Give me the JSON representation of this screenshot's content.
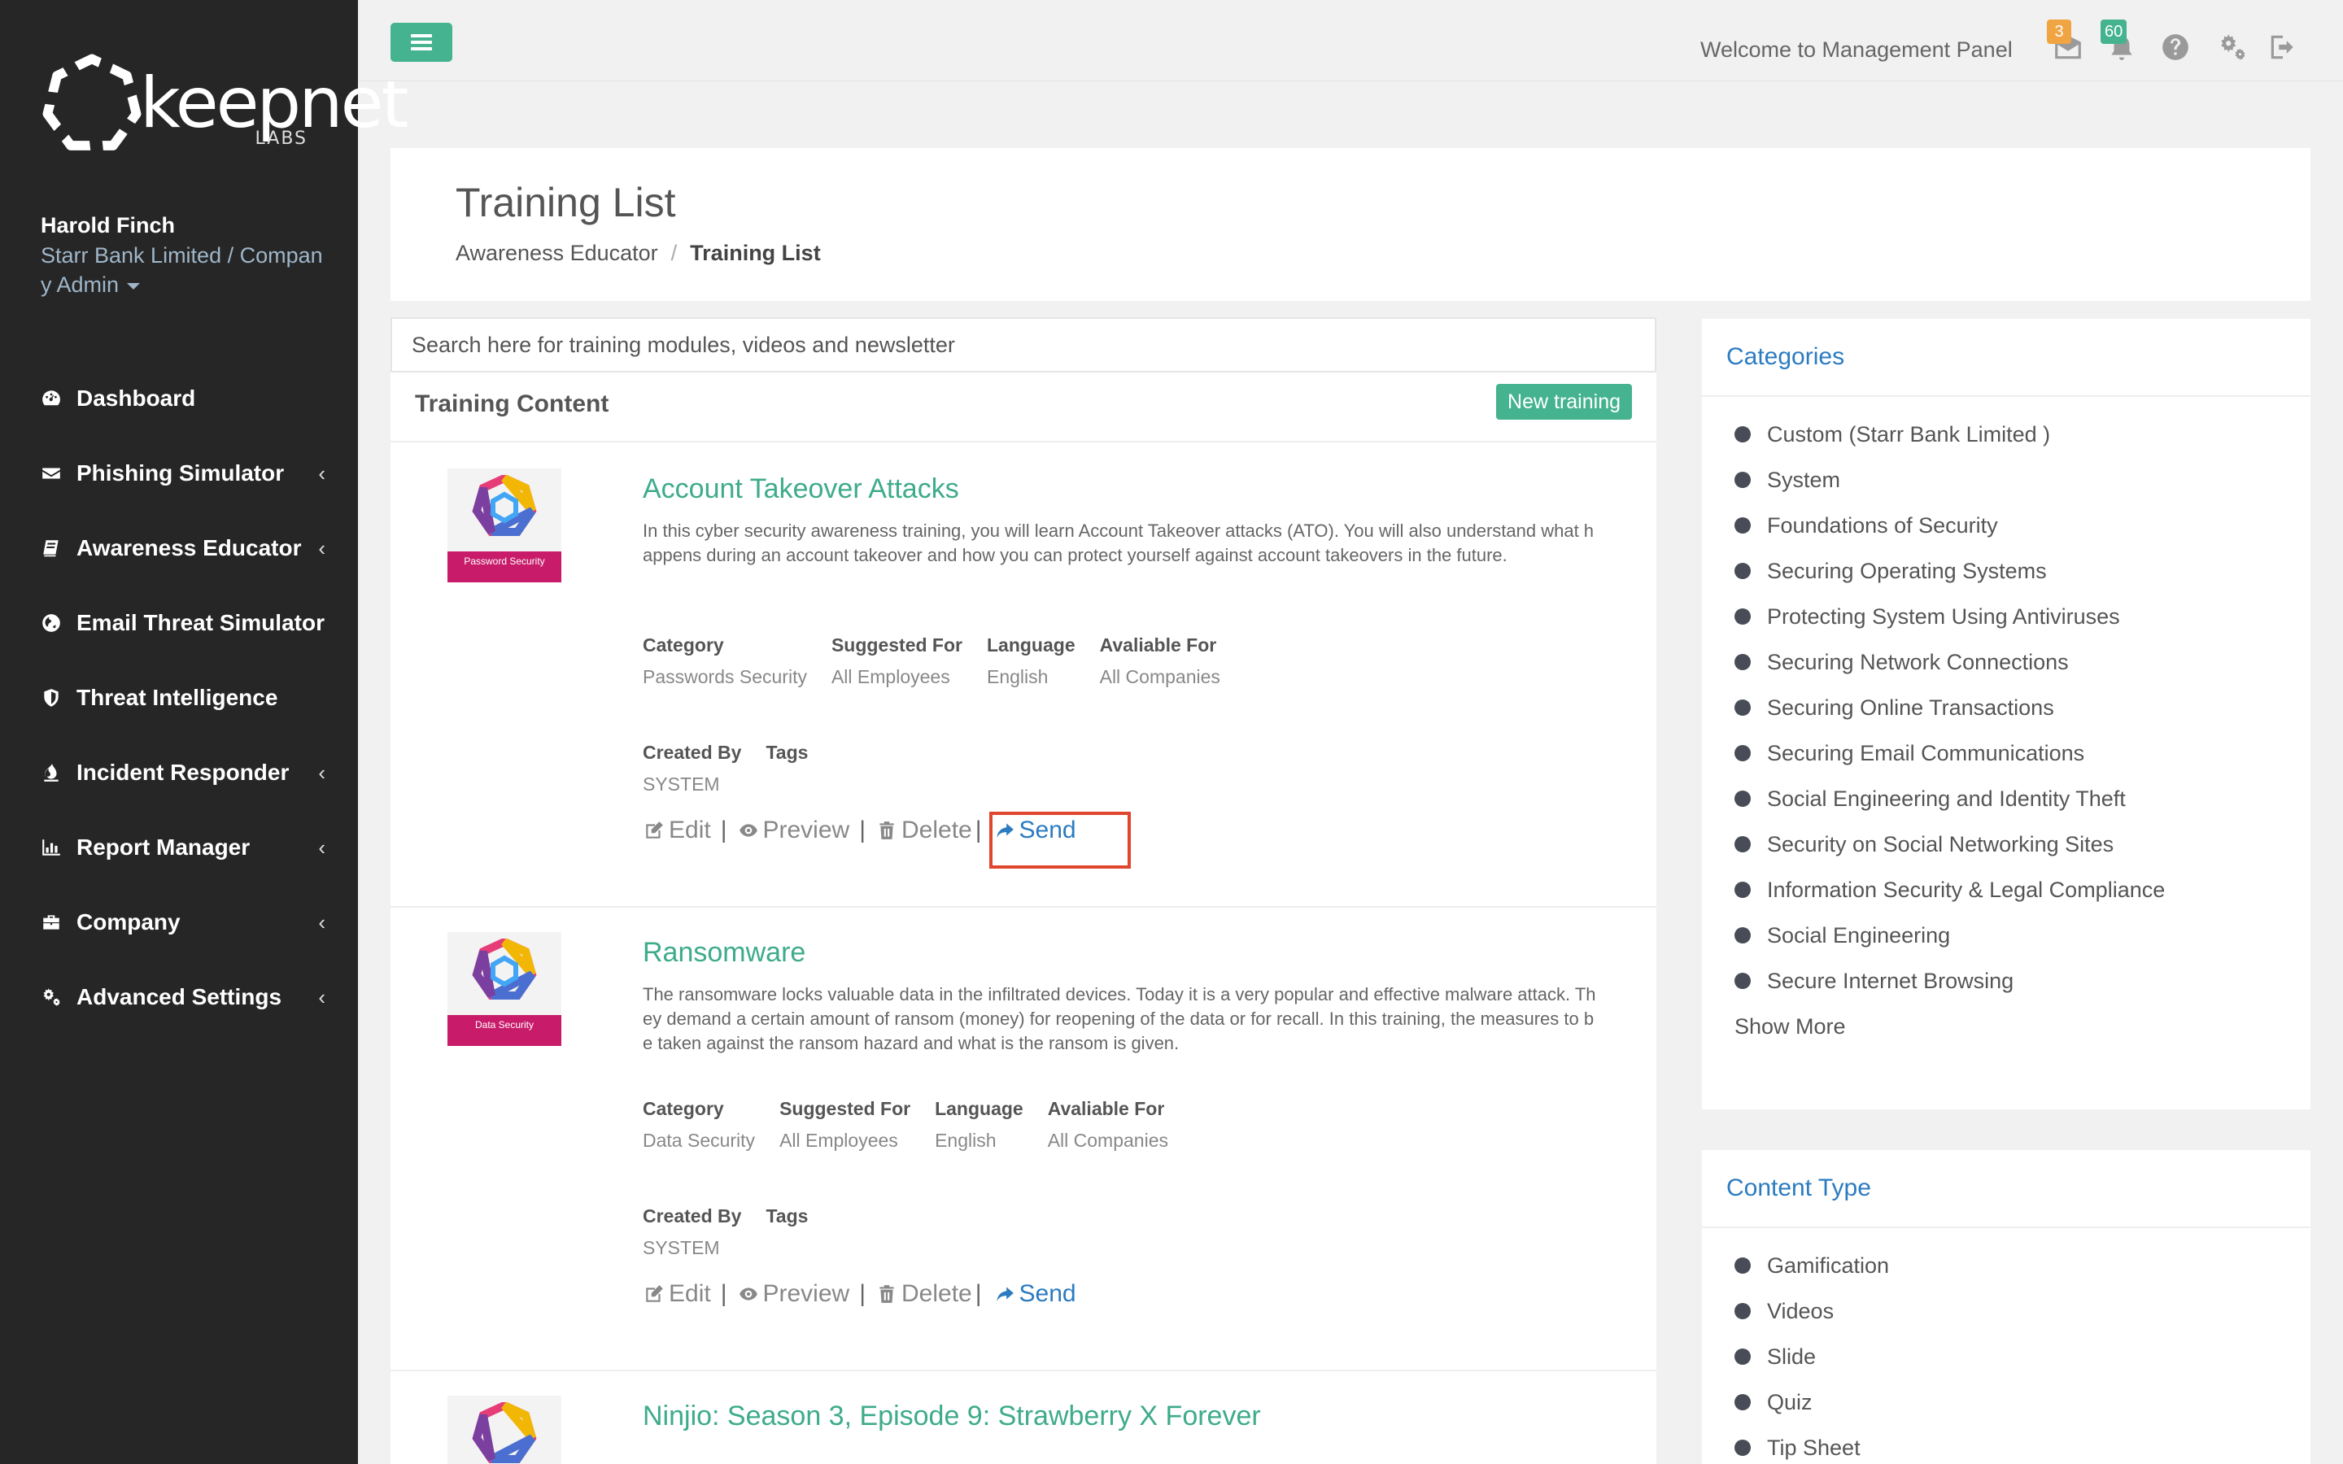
{
  "brand": {
    "name": "keepnet",
    "sub": "LABS"
  },
  "user": {
    "name": "Harold Finch",
    "org": "Starr Bank Limited / Company Admin"
  },
  "sidebar": {
    "items": [
      {
        "label": "Dashboard",
        "icon": "dashboard-icon",
        "has_submenu": false
      },
      {
        "label": "Phishing Simulator",
        "icon": "envelope-icon",
        "has_submenu": true
      },
      {
        "label": "Awareness Educator",
        "icon": "book-icon",
        "has_submenu": true
      },
      {
        "label": "Email Threat Simulator",
        "icon": "globe-icon",
        "has_submenu": false
      },
      {
        "label": "Threat Intelligence",
        "icon": "shield-icon",
        "has_submenu": false
      },
      {
        "label": "Incident Responder",
        "icon": "fire-icon",
        "has_submenu": true
      },
      {
        "label": "Report Manager",
        "icon": "bar-chart-icon",
        "has_submenu": true
      },
      {
        "label": "Company",
        "icon": "briefcase-icon",
        "has_submenu": true
      },
      {
        "label": "Advanced Settings",
        "icon": "gears-icon",
        "has_submenu": true
      }
    ],
    "chevron": "‹"
  },
  "topbar": {
    "welcome": "Welcome to Management Panel",
    "mail_badge": "3",
    "bell_badge": "60",
    "colors": {
      "mail_badge": "#f0a442",
      "bell_badge": "#45b38f"
    }
  },
  "page": {
    "title": "Training List",
    "breadcrumb": {
      "parent": "Awareness Educator",
      "sep": "/",
      "current": "Training List"
    }
  },
  "search": {
    "placeholder": "Search here for training modules, videos and newsletter"
  },
  "content": {
    "title": "Training Content",
    "new_button": "New training",
    "meta_labels": {
      "category": "Category",
      "suggested": "Suggested For",
      "language": "Language",
      "available": "Avaliable For",
      "created_by": "Created By",
      "tags": "Tags"
    },
    "action_labels": {
      "edit": "Edit",
      "preview": "Preview",
      "delete": "Delete",
      "send": "Send",
      "bar": "|"
    },
    "items": [
      {
        "title": "Account Takeover Attacks",
        "thumb_label": "Password Security",
        "description": "In this cyber security awareness training, you will learn Account Takeover attacks (ATO). You will also understand what happens during an account takeover and how you can protect yourself against account takeovers in the future.",
        "category": "Passwords Security",
        "suggested": "All Employees",
        "language": "English",
        "available": "All Companies",
        "created_by": "SYSTEM",
        "tags": ""
      },
      {
        "title": "Ransomware",
        "thumb_label": "Data Security",
        "description": "The ransomware locks valuable data in the infiltrated devices. Today it is a very popular and effective malware attack. They demand a certain amount of ransom (money) for reopening of the data or for recall. In this training, the measures to be taken against the ransom hazard and what is the ransom is given.",
        "category": "Data Security",
        "suggested": "All Employees",
        "language": "English",
        "available": "All Companies",
        "created_by": "SYSTEM",
        "tags": ""
      },
      {
        "title": "Ninjio: Season 3, Episode 9: Strawberry X Forever"
      }
    ]
  },
  "categories": {
    "title": "Categories",
    "items": [
      "Custom (Starr Bank Limited )",
      "System",
      "Foundations of Security",
      "Securing Operating Systems",
      "Protecting System Using Antiviruses",
      "Securing Network Connections",
      "Securing Online Transactions",
      "Securing Email Communications",
      "Social Engineering and Identity Theft",
      "Security on Social Networking Sites",
      "Information Security & Legal Compliance",
      "Social Engineering",
      "Secure Internet Browsing"
    ],
    "show_more": "Show More"
  },
  "content_type": {
    "title": "Content Type",
    "items": [
      "Gamification",
      "Videos",
      "Slide",
      "Quiz",
      "Tip Sheet"
    ]
  },
  "colors": {
    "sidebar_bg": "#262626",
    "accent_green": "#45b38f",
    "title_green": "#3eab8b",
    "link_blue": "#2b7bc0",
    "highlight_red": "#e0462e"
  }
}
